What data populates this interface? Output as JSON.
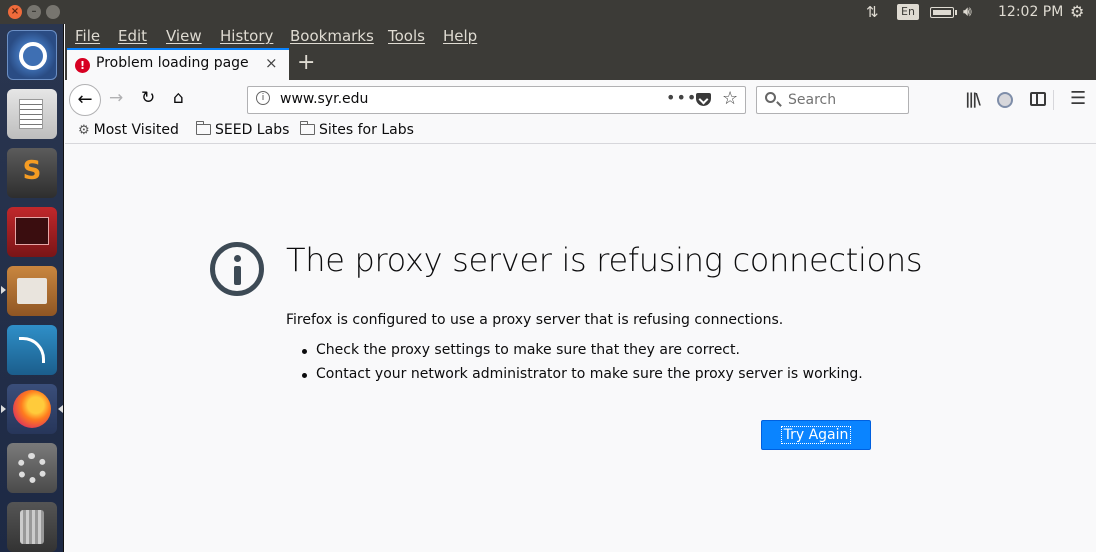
{
  "system": {
    "language": "En",
    "clock": "12:02 PM"
  },
  "menubar": {
    "items": [
      "File",
      "Edit",
      "View",
      "History",
      "Bookmarks",
      "Tools",
      "Help"
    ]
  },
  "tab": {
    "title": "Problem loading page",
    "close": "×",
    "new_tab": "+"
  },
  "navbar": {
    "url": "www.syr.edu",
    "url_dots": "•••",
    "search_placeholder": "Search"
  },
  "bookmarks": {
    "items": [
      "Most Visited",
      "SEED Labs",
      "Sites for Labs"
    ]
  },
  "error": {
    "title": "The proxy server is refusing connections",
    "description": "Firefox is configured to use a proxy server that is refusing connections.",
    "bullets": [
      "Check the proxy settings to make sure that they are correct.",
      "Contact your network administrator to make sure the proxy server is working."
    ],
    "button": "Try Again"
  },
  "colors": {
    "accent": "#0a84ff",
    "panel": "#3c3b37",
    "error_icon": "#3d4a55",
    "tab_warning": "#d70022"
  },
  "icons": {
    "launcher": [
      "ubuntu-dash-icon",
      "text-editor-icon",
      "sublime-text-icon",
      "terminal-icon",
      "files-icon",
      "wireshark-icon",
      "firefox-icon",
      "system-settings-icon",
      "trash-icon"
    ],
    "tray": [
      "network-icon",
      "battery-icon",
      "volume-icon",
      "gear-icon"
    ]
  }
}
